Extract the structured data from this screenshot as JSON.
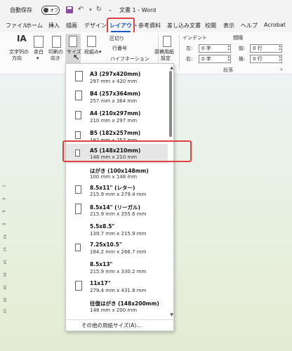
{
  "titlebar": {
    "autosave_label": "自動保存",
    "toggle_state": "オフ",
    "doc_title": "文書 1 - Word"
  },
  "tabs": [
    {
      "label": "ファイル"
    },
    {
      "label": "ホーム"
    },
    {
      "label": "挿入"
    },
    {
      "label": "描画"
    },
    {
      "label": "デザイン"
    },
    {
      "label": "レイアウト",
      "active": true
    },
    {
      "label": "参考資料"
    },
    {
      "label": "差し込み文書"
    },
    {
      "label": "校閲"
    },
    {
      "label": "表示"
    },
    {
      "label": "ヘルプ"
    },
    {
      "label": "Acrobat"
    }
  ],
  "ribbon": {
    "text_direction": [
      "文字列の",
      "方向"
    ],
    "margins": [
      "余白",
      "▾"
    ],
    "orientation": [
      "印刷の",
      "向き"
    ],
    "size": [
      "サイズ",
      "▾"
    ],
    "columns": [
      "段組み",
      "▾"
    ],
    "breaks": "区切り",
    "line_numbers": "行番号",
    "hyphenation": "ハイフネーション",
    "manuscript": [
      "原稿用紙",
      "設定"
    ],
    "indent_header": "インデント",
    "spacing_header": "間隔",
    "indent_left_label": "左:",
    "indent_left_value": "0 字",
    "indent_right_label": "右:",
    "indent_right_value": "0 字",
    "space_before_label": "前:",
    "space_before_value": "0 行",
    "space_after_label": "後:",
    "space_after_value": "0 行",
    "paragraph_group": "段落"
  },
  "size_menu": {
    "items": [
      {
        "name": "A3 (297x420mm)",
        "dims": "297 mm x 420 mm"
      },
      {
        "name": "B4 (257x364mm)",
        "dims": "257 mm x 364 mm"
      },
      {
        "name": "A4 (210x297mm)",
        "dims": "210 mm x 297 mm"
      },
      {
        "name": "B5 (182x257mm)",
        "dims": "182 mm x 257 mm"
      },
      {
        "name": "A5 (148x210mm)",
        "dims": "148 mm x 210 mm",
        "selected": true
      },
      {
        "name": "はがき (100x148mm)",
        "dims": "100 mm x 148 mm"
      },
      {
        "name": "8.5x11\" (レター)",
        "dims": "215.9 mm x 279.4 mm"
      },
      {
        "name": "8.5x14\" (リーガル)",
        "dims": "215.9 mm x 355.6 mm"
      },
      {
        "name": "5.5x8.5\"",
        "dims": "139.7 mm x 215.9 mm"
      },
      {
        "name": "7.25x10.5\"",
        "dims": "184.2 mm x 266.7 mm"
      },
      {
        "name": "8.5x13\"",
        "dims": "215.9 mm x 330.2 mm"
      },
      {
        "name": "11x17\"",
        "dims": "279.4 mm x 431.8 mm"
      },
      {
        "name": "往復はがき (148x200mm)",
        "dims": "148 mm x 200 mm"
      }
    ],
    "more_label": "その他の用紙サイズ(A)..."
  },
  "ruler": [
    "2",
    "4",
    "6",
    "8",
    "10",
    "12",
    "14",
    "16",
    "18",
    "20",
    "22"
  ]
}
